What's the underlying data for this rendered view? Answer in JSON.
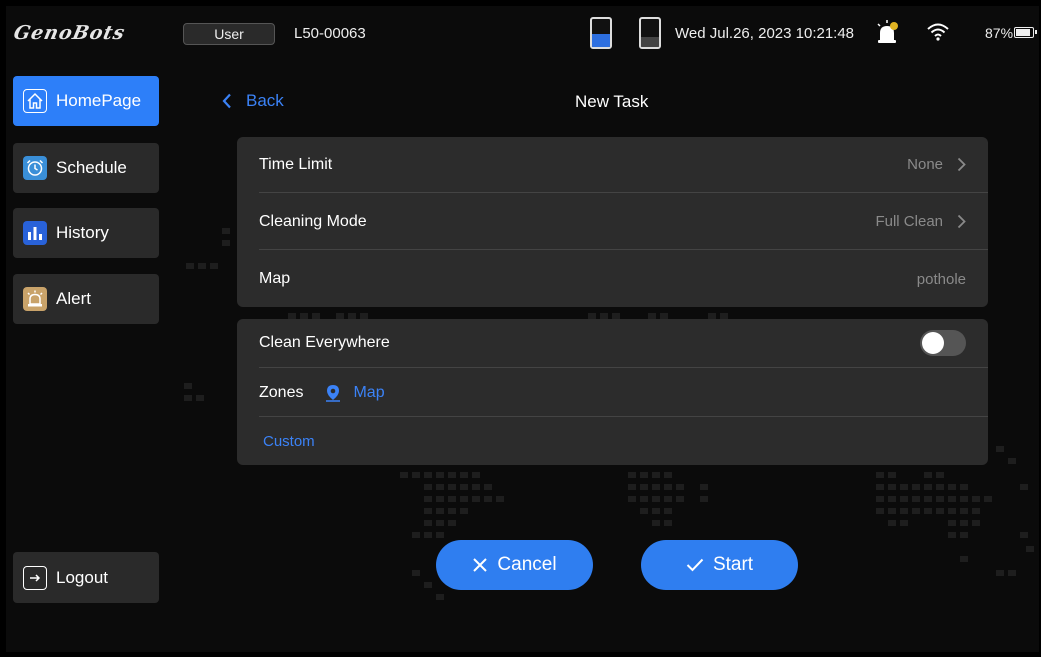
{
  "header": {
    "logo_text": "GenoBots",
    "user_badge": "User",
    "device_id": "L50-00063",
    "datetime": "Wed Jul.26, 2023 10:21:48",
    "battery_percent": "87%",
    "battery_level": 0.87,
    "tank_clean_level": 0.45,
    "tank_dirty_level": 0.35
  },
  "sidebar": {
    "items": [
      {
        "label": "HomePage",
        "icon": "home-icon",
        "active": true
      },
      {
        "label": "Schedule",
        "icon": "alarm-clock-icon",
        "active": false
      },
      {
        "label": "History",
        "icon": "bar-chart-icon",
        "active": false
      },
      {
        "label": "Alert",
        "icon": "alarm-light-icon",
        "active": false
      }
    ],
    "logout_label": "Logout"
  },
  "page": {
    "back_label": "Back",
    "title": "New Task"
  },
  "settings": {
    "time_limit_label": "Time Limit",
    "time_limit_value": "None",
    "cleaning_mode_label": "Cleaning Mode",
    "cleaning_mode_value": "Full Clean",
    "map_label": "Map",
    "map_value": "pothole"
  },
  "zones": {
    "clean_everywhere_label": "Clean Everywhere",
    "clean_everywhere_on": false,
    "zones_label": "Zones",
    "map_link": "Map",
    "custom_link": "Custom"
  },
  "actions": {
    "cancel_label": "Cancel",
    "start_label": "Start"
  },
  "colors": {
    "accent": "#2d7ff9",
    "link": "#3b82f6",
    "card": "#2c2c2c",
    "background": "#0b0b0b",
    "schedule_icon_bg": "#3a8fd8",
    "history_icon_bg": "#2962d9",
    "alert_icon_bg": "#c9a36a"
  }
}
